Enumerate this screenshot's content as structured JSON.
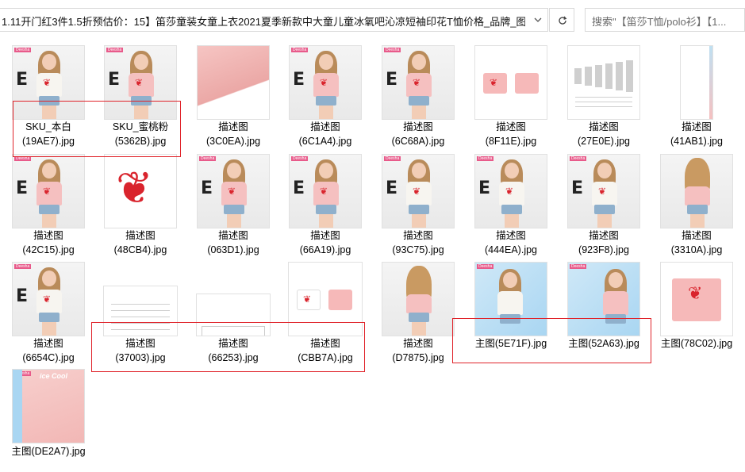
{
  "address": {
    "path": "1.11开门红3件1.5折预估价：15】笛莎童装女童上衣2021夏季新款中大童儿童冰氧吧沁凉短袖印花T恤价格_品牌_图...",
    "search_placeholder": "搜索\"【笛莎T恤/polo衫】【1..."
  },
  "files": [
    {
      "line1": "SKU_本白",
      "line2": "(19AE7).jpg",
      "kind": "girl-white"
    },
    {
      "line1": "SKU_蜜桃粉",
      "line2": "(5362B).jpg",
      "kind": "girl-pink"
    },
    {
      "line1": "描述图",
      "line2": "(3C0EA).jpg",
      "kind": "fabric"
    },
    {
      "line1": "描述图",
      "line2": "(6C1A4).jpg",
      "kind": "girl-pink"
    },
    {
      "line1": "描述图",
      "line2": "(6C68A).jpg",
      "kind": "girl-pink"
    },
    {
      "line1": "描述图",
      "line2": "(8F11E).jpg",
      "kind": "tees"
    },
    {
      "line1": "描述图",
      "line2": "(27E0E).jpg",
      "kind": "chart"
    },
    {
      "line1": "描述图",
      "line2": "(41AB1).jpg",
      "kind": "tall"
    },
    {
      "line1": "描述图",
      "line2": "(42C15).jpg",
      "kind": "girl-pink"
    },
    {
      "line1": "描述图",
      "line2": "(48CB4).jpg",
      "kind": "bowbig"
    },
    {
      "line1": "描述图",
      "line2": "(063D1).jpg",
      "kind": "girl-pink"
    },
    {
      "line1": "描述图",
      "line2": "(66A19).jpg",
      "kind": "girl-pink"
    },
    {
      "line1": "描述图",
      "line2": "(93C75).jpg",
      "kind": "girl-white"
    },
    {
      "line1": "描述图",
      "line2": "(444EA).jpg",
      "kind": "girl-white"
    },
    {
      "line1": "描述图",
      "line2": "(923F8).jpg",
      "kind": "girl-white"
    },
    {
      "line1": "描述图",
      "line2": "(3310A).jpg",
      "kind": "girl-back"
    },
    {
      "line1": "描述图",
      "line2": "(6654C).jpg",
      "kind": "girl-white"
    },
    {
      "line1": "描述图",
      "line2": "(37003).jpg",
      "kind": "table"
    },
    {
      "line1": "描述图",
      "line2": "(66253).jpg",
      "kind": "label"
    },
    {
      "line1": "描述图",
      "line2": "(CBB7A).jpg",
      "kind": "tees2"
    },
    {
      "line1": "描述图",
      "line2": "(D7875).jpg",
      "kind": "girl-back"
    },
    {
      "line1": "主图(5E71F).jpg",
      "line2": "",
      "kind": "main-blue"
    },
    {
      "line1": "主图(52A63).jpg",
      "line2": "",
      "kind": "main-blue2"
    },
    {
      "line1": "主图(78C02).jpg",
      "line2": "",
      "kind": "tee-single"
    },
    {
      "line1": "主图(DE2A7).jpg",
      "line2": "",
      "kind": "main-fabric"
    }
  ],
  "thumb_text": {
    "badge": "Deesha",
    "cool": "ice Cool"
  },
  "colors": {
    "highlight": "#e0242b",
    "pink": "#f6b9b9",
    "bow_red": "#d9242d"
  }
}
